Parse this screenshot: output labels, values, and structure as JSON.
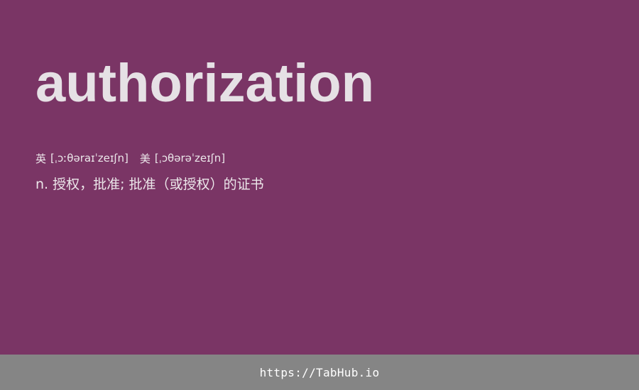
{
  "entry": {
    "word": "authorization",
    "phonetics": {
      "uk_label": "英",
      "uk_ipa": "[ˌɔːθəraɪˈzeɪʃn]",
      "us_label": "美",
      "us_ipa": "[ˌɔθərəˈzeɪʃn]"
    },
    "definition": "n. 授权，批准; 批准（或授权）的证书"
  },
  "footer": {
    "link_text": "https://TabHub.io"
  },
  "colors": {
    "background": "#7a3565",
    "word_text": "#e6e1e5",
    "footer_bar": "#858585"
  }
}
